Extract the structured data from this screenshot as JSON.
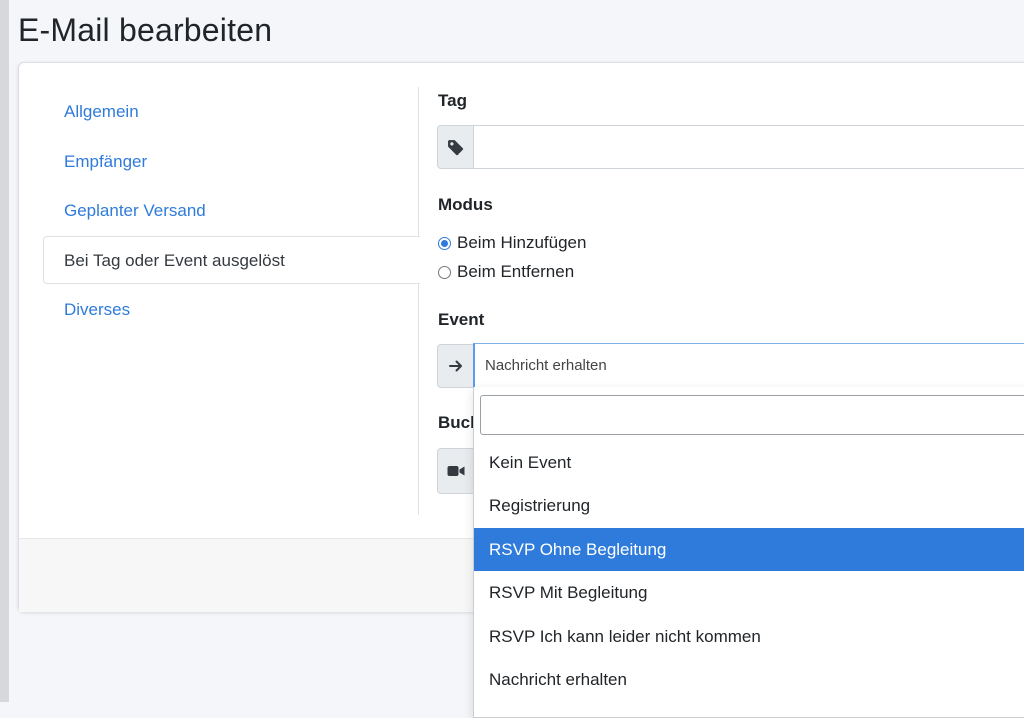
{
  "page": {
    "title": "E-Mail bearbeiten"
  },
  "nav": {
    "items": [
      {
        "label": "Allgemein",
        "active": false
      },
      {
        "label": "Empfänger",
        "active": false
      },
      {
        "label": "Geplanter Versand",
        "active": false
      },
      {
        "label": "Bei Tag oder Event ausgelöst",
        "active": true
      },
      {
        "label": "Diverses",
        "active": false
      }
    ]
  },
  "form": {
    "tag": {
      "label": "Tag",
      "value": "",
      "icon": "tag-icon"
    },
    "modus": {
      "label": "Modus",
      "options": [
        {
          "label": "Beim Hinzufügen",
          "checked": true
        },
        {
          "label": "Beim Entfernen",
          "checked": false
        }
      ]
    },
    "event": {
      "label": "Event",
      "icon": "arrow-right-icon",
      "selected": "Nachricht erhalten",
      "search_value": "",
      "options": [
        {
          "label": "Kein Event",
          "highlighted": false
        },
        {
          "label": "Registrierung",
          "highlighted": false
        },
        {
          "label": "RSVP Ohne Begleitung",
          "highlighted": true
        },
        {
          "label": "RSVP Mit Begleitung",
          "highlighted": false
        },
        {
          "label": "RSVP Ich kann leider nicht kommen",
          "highlighted": false
        },
        {
          "label": "Nachricht erhalten",
          "highlighted": false
        }
      ]
    },
    "buchung": {
      "label_partial": "Buch",
      "icon": "video-camera-icon"
    }
  },
  "colors": {
    "accent": "#2f7bdc",
    "addon_bg": "#e9ecef",
    "border": "#ced4da"
  }
}
